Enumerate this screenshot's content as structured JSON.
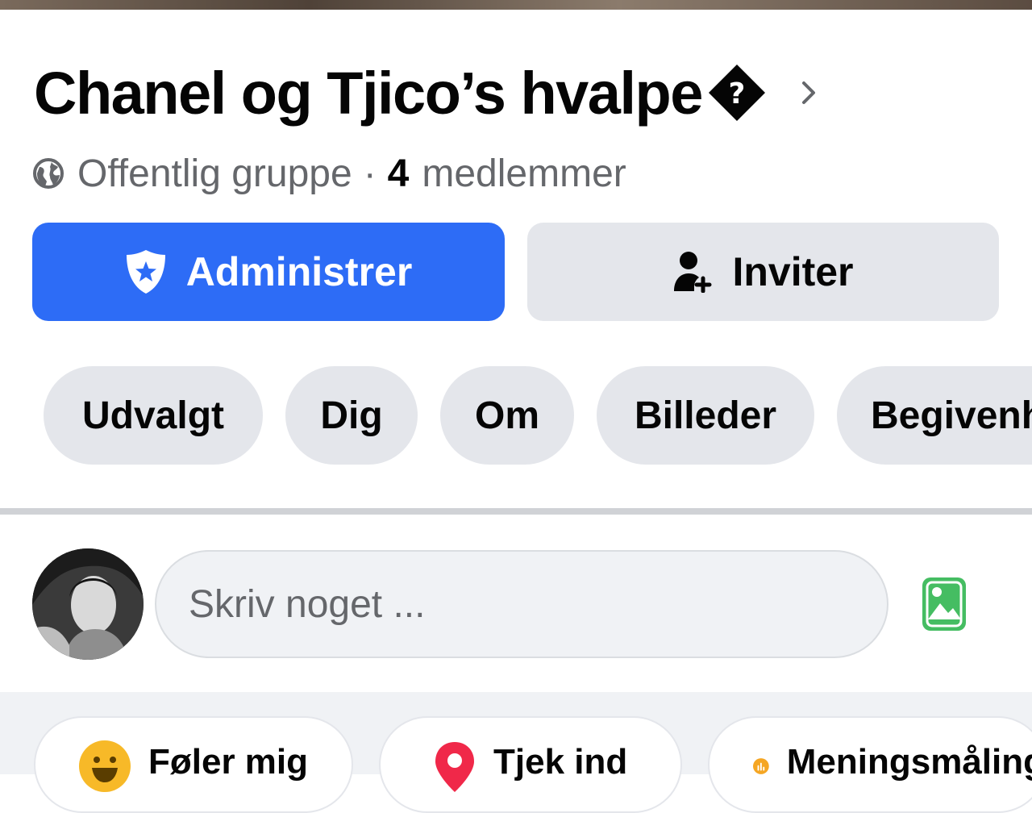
{
  "group": {
    "name": "Chanel og Tjico’s hvalpe",
    "privacy": "Offentlig gruppe",
    "separator": "·",
    "member_count": "4",
    "member_label": "medlemmer"
  },
  "buttons": {
    "manage_label": "Administrer",
    "invite_label": "Inviter"
  },
  "tabs": [
    {
      "label": "Udvalgt"
    },
    {
      "label": "Dig"
    },
    {
      "label": "Om"
    },
    {
      "label": "Billeder"
    },
    {
      "label": "Begivenheder"
    }
  ],
  "composer": {
    "placeholder": "Skriv noget ..."
  },
  "actions": [
    {
      "label": "Føler mig",
      "icon": "smiley-icon",
      "color": "#f7b928"
    },
    {
      "label": "Tjek ind",
      "icon": "location-pin-icon",
      "color": "#f02849"
    },
    {
      "label": "Meningsmåling",
      "icon": "poll-icon",
      "color": "#f5a623"
    }
  ],
  "colors": {
    "primary": "#2d6cf6",
    "secondary_button": "#e4e6eb",
    "photo_icon": "#45bd62",
    "muted_text": "#65676b"
  },
  "icons": {
    "title_glyph": "unknown-character-icon",
    "title_chevron": "chevron-right-icon",
    "privacy": "globe-icon",
    "manage": "shield-star-icon",
    "invite": "add-person-icon",
    "photo": "photo-icon"
  }
}
